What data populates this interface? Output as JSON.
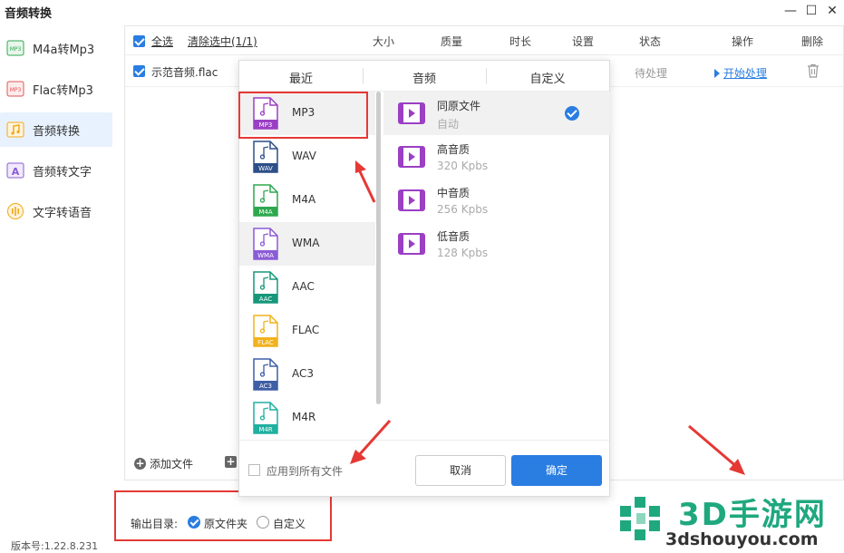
{
  "app": {
    "title": "音频转换",
    "version": "版本号:1.22.8.231"
  },
  "window_controls": {
    "minimize": "—",
    "maximize": "☐",
    "close": "✕"
  },
  "sidebar": {
    "items": [
      {
        "label": "M4a转Mp3",
        "icon": "m4a-to-mp3-icon",
        "active": false
      },
      {
        "label": "Flac转Mp3",
        "icon": "flac-to-mp3-icon",
        "active": false
      },
      {
        "label": "音频转换",
        "icon": "audio-convert-icon",
        "active": true
      },
      {
        "label": "音频转文字",
        "icon": "audio-to-text-icon",
        "active": false
      },
      {
        "label": "文字转语音",
        "icon": "text-to-speech-icon",
        "active": false
      }
    ]
  },
  "table": {
    "select_all": "全选",
    "clear_selected": "清除选中(1/1)",
    "headers": [
      "大小",
      "质量",
      "时长",
      "设置",
      "状态",
      "操作",
      "删除"
    ],
    "rows": [
      {
        "name": "示范音频.flac",
        "status": "待处理",
        "action": "开始处理"
      }
    ],
    "add_file": "添加文件"
  },
  "output": {
    "label": "输出目录:",
    "options": [
      "原文件夹",
      "自定义"
    ],
    "selected": "原文件夹"
  },
  "popup": {
    "tabs": [
      "最近",
      "音频",
      "自定义"
    ],
    "formats": [
      {
        "name": "MP3",
        "tag": "MP3",
        "color": "#9b3fc4"
      },
      {
        "name": "WAV",
        "tag": "WAV",
        "color": "#2d4f8a"
      },
      {
        "name": "M4A",
        "tag": "M4A",
        "color": "#2ea84f"
      },
      {
        "name": "WMA",
        "tag": "WMA",
        "color": "#8b5cd6"
      },
      {
        "name": "AAC",
        "tag": "AAC",
        "color": "#16977a"
      },
      {
        "name": "FLAC",
        "tag": "FLAC",
        "color": "#f2b21c"
      },
      {
        "name": "AC3",
        "tag": "AC3",
        "color": "#3e5ea5"
      },
      {
        "name": "M4R",
        "tag": "M4R",
        "color": "#1fb0a0"
      }
    ],
    "selected_format": "MP3",
    "qualities": [
      {
        "title": "同原文件",
        "sub": "自动",
        "selected": true
      },
      {
        "title": "高音质",
        "sub": "320 Kpbs",
        "selected": false
      },
      {
        "title": "中音质",
        "sub": "256 Kpbs",
        "selected": false
      },
      {
        "title": "低音质",
        "sub": "128 Kpbs",
        "selected": false
      }
    ],
    "apply_all": "应用到所有文件",
    "cancel": "取消",
    "confirm": "确定"
  },
  "watermark": {
    "brand": "3D手游网",
    "url": "3dshouyou.com"
  },
  "colors": {
    "accent": "#2a7de1",
    "highlight_red": "#e53935",
    "active_nav_bg": "#e8f2fe"
  }
}
